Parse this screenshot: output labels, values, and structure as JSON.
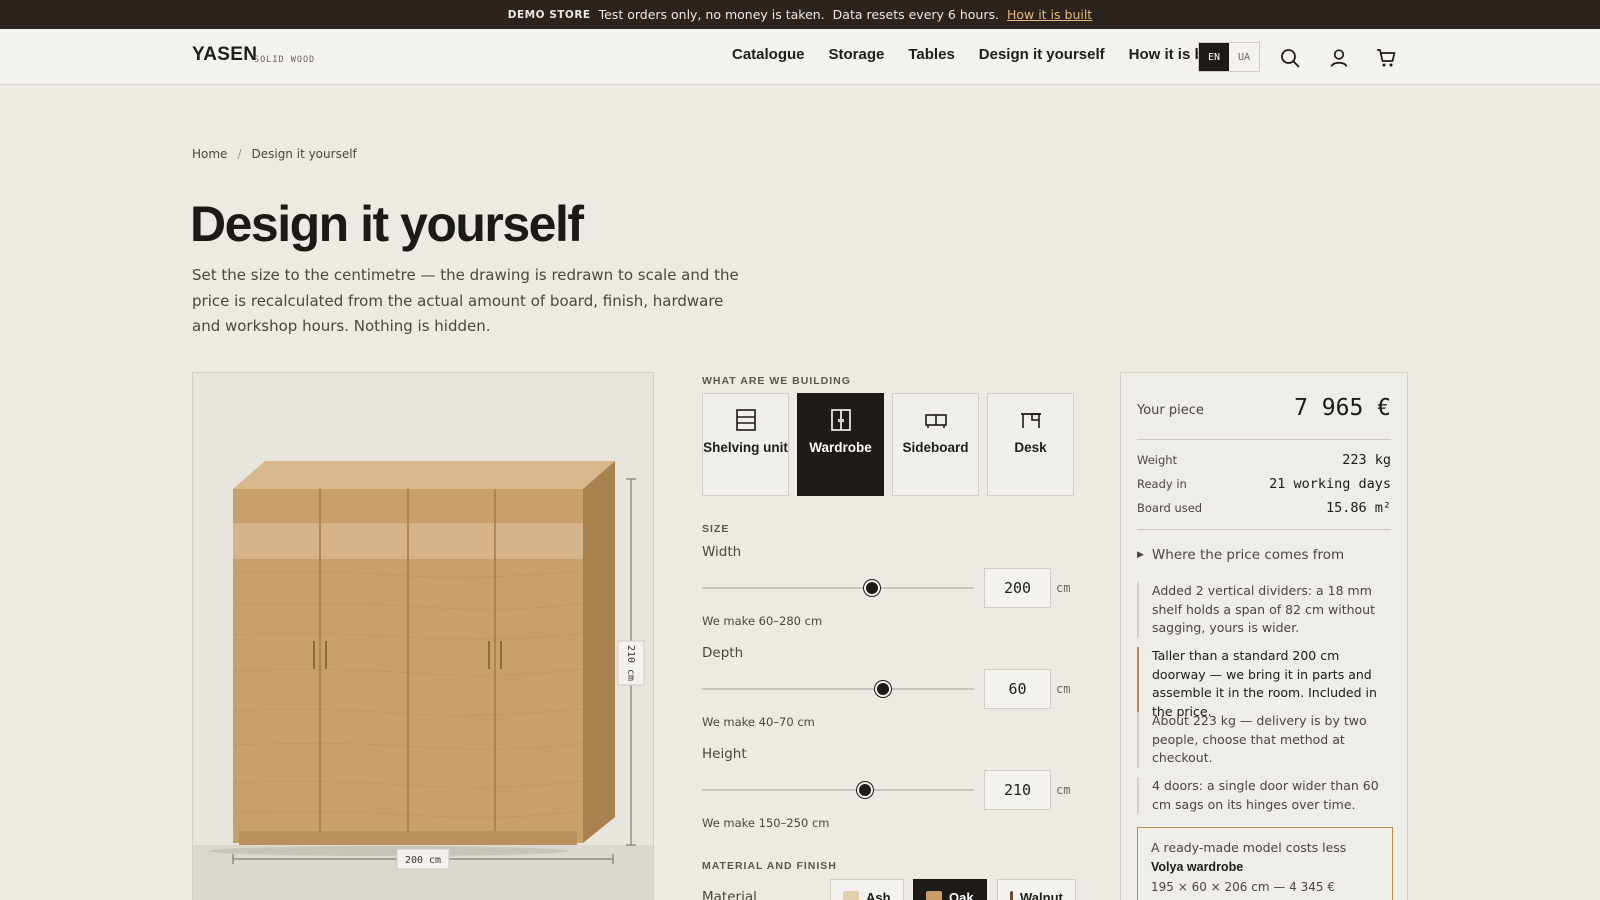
{
  "demo_bar": {
    "tag": "DEMO STORE",
    "text": "Test orders only, no money is taken.",
    "reset": "Data resets every 6 hours.",
    "link": "How it is built"
  },
  "header": {
    "logo": "YASEN",
    "logo_sub": "SOLID WOOD",
    "nav": [
      "Catalogue",
      "Storage",
      "Tables",
      "Design it yourself",
      "How it is built"
    ],
    "lang_active": "EN",
    "lang_other": "UA",
    "icons": [
      "search-icon",
      "user-icon",
      "cart-icon"
    ]
  },
  "breadcrumb": {
    "home": "Home",
    "sep": "/",
    "current": "Design it yourself"
  },
  "hero": {
    "title": "Design it yourself",
    "lead": "Set the size to the centimetre — the drawing is redrawn to scale and the price is recalculated from the actual amount of board, finish, hardware and workshop hours. Nothing is hidden."
  },
  "preview": {
    "width_label": "200 cm",
    "height_label": "210 cm",
    "door_count": 4
  },
  "config": {
    "type_label": "WHAT ARE WE BUILDING",
    "types": [
      {
        "label": "Shelving unit",
        "icon": "shelving-icon",
        "active": false
      },
      {
        "label": "Wardrobe",
        "icon": "wardrobe-icon",
        "active": true
      },
      {
        "label": "Sideboard",
        "icon": "sideboard-icon",
        "active": false
      },
      {
        "label": "Desk",
        "icon": "desk-icon",
        "active": false
      }
    ],
    "size_label": "SIZE",
    "width": {
      "label": "Width",
      "value": "200",
      "unit": "cm",
      "hint": "We make 60–280 cm",
      "level": 0.625
    },
    "depth": {
      "label": "Depth",
      "value": "60",
      "unit": "cm",
      "hint": "We make 40–70 cm",
      "level": 0.667
    },
    "height": {
      "label": "Height",
      "value": "210",
      "unit": "cm",
      "hint": "We make 150–250 cm",
      "level": 0.6
    },
    "material_label": "MATERIAL AND FINISH",
    "material_field": "Material",
    "materials": [
      {
        "label": "Ash",
        "color": "#e2cfae",
        "active": false
      },
      {
        "label": "Oak",
        "color": "#c89d68",
        "active": true
      },
      {
        "label": "Walnut",
        "color": "#6b4a30",
        "active": false
      }
    ]
  },
  "price": {
    "label": "Your piece",
    "value": "7 965 €",
    "rows": [
      {
        "k": "Weight",
        "v": "223 kg"
      },
      {
        "k": "Ready in",
        "v": "21 working days"
      },
      {
        "k": "Board used",
        "v": "15.86 m²"
      }
    ],
    "toggle": "Where the price comes from",
    "notes": [
      {
        "text": "Added 2 vertical dividers: a 18 mm shelf holds a span of 82 cm without sagging, yours is wider.",
        "warn": false
      },
      {
        "text": "Taller than a standard 200 cm doorway — we bring it in parts and assemble it in the room. Included in the price.",
        "warn": true
      },
      {
        "text": "About 223 kg — delivery is by two people, choose that method at checkout.",
        "warn": false
      },
      {
        "text": "4 doors: a single door wider than 60 cm sags on its hinges over time.",
        "warn": false
      }
    ],
    "ready": {
      "intro": "A ready-made model costs less",
      "name": "Volya wardrobe",
      "spec": "195 × 60 × 206 cm — 4 345 €"
    }
  },
  "colors": {
    "accent": "#1d1a17",
    "wood_front": "#c9a06c",
    "wood_side": "#a8814f",
    "warn": "#b58a4c"
  }
}
